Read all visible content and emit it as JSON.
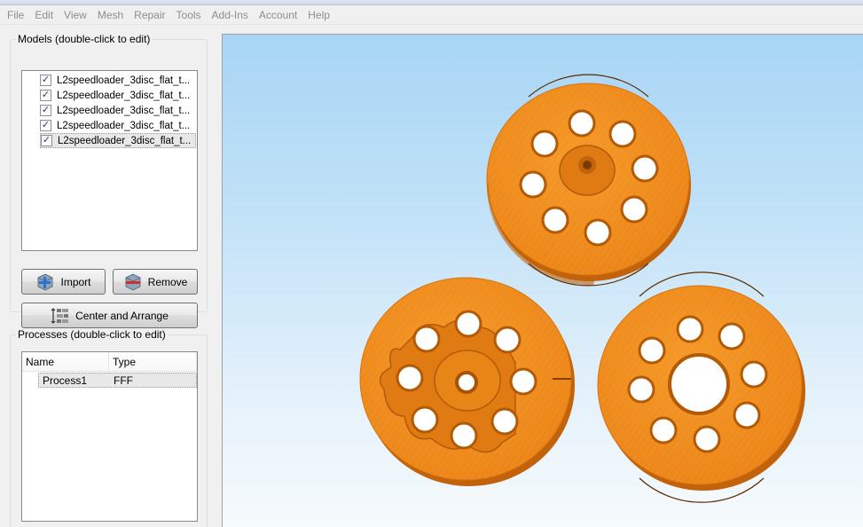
{
  "menu": {
    "items": [
      "File",
      "Edit",
      "View",
      "Mesh",
      "Repair",
      "Tools",
      "Add-Ins",
      "Account",
      "Help"
    ]
  },
  "models_panel": {
    "title": "Models (double-click to edit)",
    "items": [
      {
        "label": "L2speedloader_3disc_flat_t...",
        "checked": true
      },
      {
        "label": "L2speedloader_3disc_flat_t...",
        "checked": true
      },
      {
        "label": "L2speedloader_3disc_flat_t...",
        "checked": true
      },
      {
        "label": "L2speedloader_3disc_flat_t...",
        "checked": true
      },
      {
        "label": "L2speedloader_3disc_flat_t...",
        "checked": true
      }
    ],
    "import_label": "Import",
    "remove_label": "Remove",
    "center_arrange_label": "Center and Arrange"
  },
  "processes_panel": {
    "title": "Processes (double-click to edit)",
    "columns": [
      "Name",
      "Type"
    ],
    "rows": [
      {
        "name": "Process1",
        "type": "FFF"
      }
    ]
  },
  "colors": {
    "model_orange": "#f08c1c",
    "model_shadow": "#c5650a",
    "viewport_top": "#a8d5f5",
    "viewport_bottom": "#f6fafd"
  }
}
